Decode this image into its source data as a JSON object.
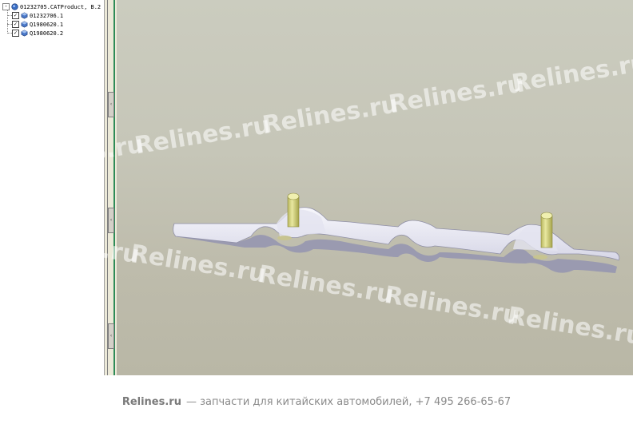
{
  "tree": {
    "root_label": "01232705.CATProduct, B.2",
    "root_expander": "-",
    "children": [
      {
        "label": "01232706.1",
        "checked": true
      },
      {
        "label": "Q1980620.1",
        "checked": true
      },
      {
        "label": "Q1980620.2",
        "checked": true
      }
    ]
  },
  "viewport": {
    "watermark_text": "Relines.ru",
    "part_color": "#eeeef5",
    "pin_color": "#d9d98a"
  },
  "footer": {
    "brand": "Relines.ru",
    "text": "— запчасти для китайских автомобилей, +7 495 266-65-67"
  },
  "icons": {
    "product": "product-node-icon",
    "part": "part-node-icon",
    "checkbox": "checkbox-icon"
  }
}
